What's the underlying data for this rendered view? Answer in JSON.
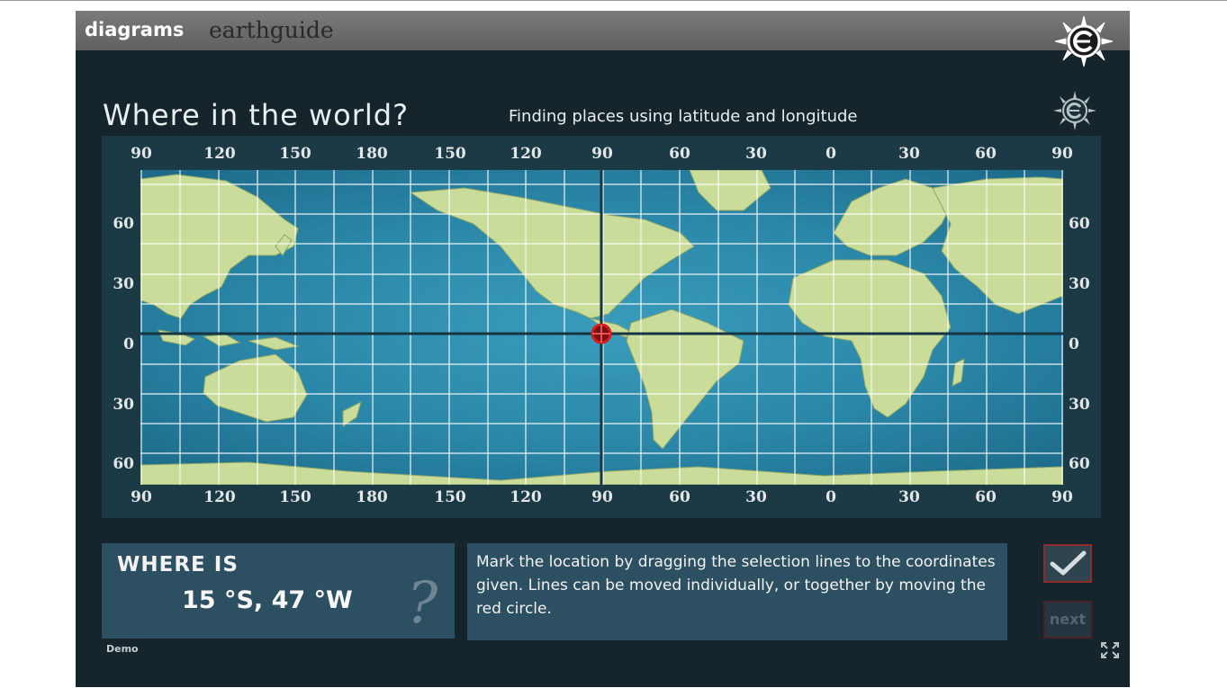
{
  "header": {
    "brand_primary": "diagrams",
    "brand_secondary": "earthguide",
    "logo_icon": "compass-e-logo-icon"
  },
  "page": {
    "title": "Where in the world?",
    "subtitle": "Finding places using latitude and longitude"
  },
  "map": {
    "lon_ticks": [
      "90",
      "120",
      "150",
      "180",
      "150",
      "120",
      "90",
      "60",
      "30",
      "0",
      "30",
      "60",
      "90"
    ],
    "lat_ticks": [
      "60",
      "30",
      "0",
      "30",
      "60"
    ],
    "selection": {
      "longitude_line": "90",
      "latitude_line": "0"
    },
    "colors": {
      "ocean": "#2a86a6",
      "land": "#c9dc9a",
      "grid": "#ffffff",
      "selection_line": "#163441",
      "marker": "#d81b1b"
    }
  },
  "question": {
    "label": "WHERE IS",
    "coordinates": "15 °S, 47 °W",
    "hint": "?"
  },
  "instructions": {
    "text": "Mark the location by dragging the selection lines to the coordinates given.  Lines can be moved individually, or together by moving the red circle."
  },
  "controls": {
    "check_icon": "checkmark-icon",
    "next_label": "next",
    "fullscreen_icon": "fullscreen-icon"
  },
  "footer": {
    "demo_label": "Demo"
  }
}
